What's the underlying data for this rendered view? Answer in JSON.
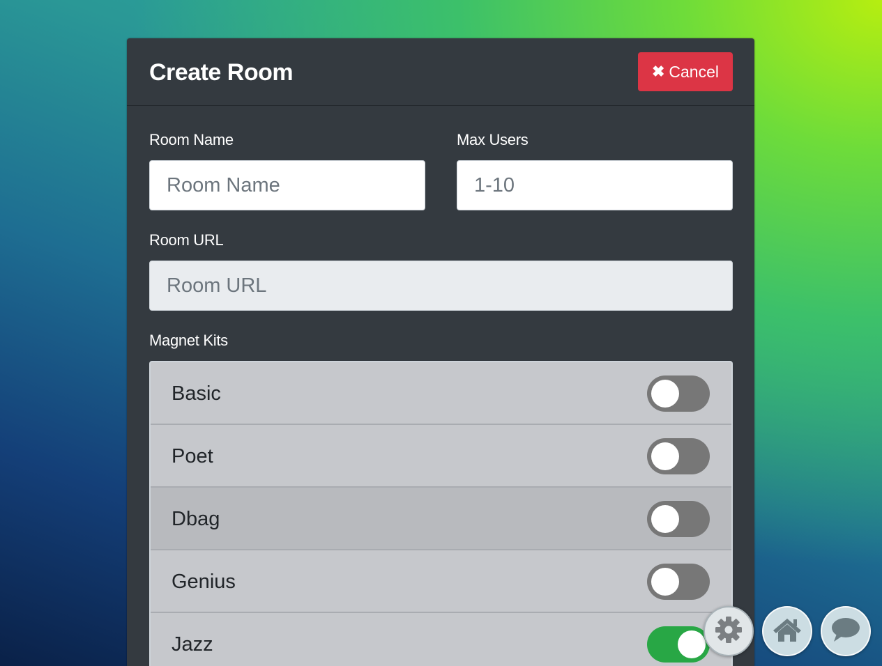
{
  "header": {
    "title": "Create Room",
    "cancel_label": "Cancel",
    "cancel_icon": "times-icon"
  },
  "form": {
    "room_name": {
      "label": "Room Name",
      "placeholder": "Room Name",
      "value": ""
    },
    "max_users": {
      "label": "Max Users",
      "placeholder": "1-10",
      "value": ""
    },
    "room_url": {
      "label": "Room URL",
      "placeholder": "Room URL",
      "value": ""
    },
    "magnet_kits": {
      "label": "Magnet Kits",
      "items": [
        {
          "name": "Basic",
          "enabled": false
        },
        {
          "name": "Poet",
          "enabled": false
        },
        {
          "name": "Dbag",
          "enabled": false
        },
        {
          "name": "Genius",
          "enabled": false
        },
        {
          "name": "Jazz",
          "enabled": true
        }
      ]
    }
  },
  "floating_buttons": [
    {
      "icon": "gear-icon"
    },
    {
      "icon": "home-icon"
    },
    {
      "icon": "speech-bubble-icon"
    }
  ],
  "colors": {
    "panel_bg": "#343a40",
    "cancel_bg": "#dc3545",
    "toggle_off": "#777777",
    "toggle_on": "#28a745"
  }
}
